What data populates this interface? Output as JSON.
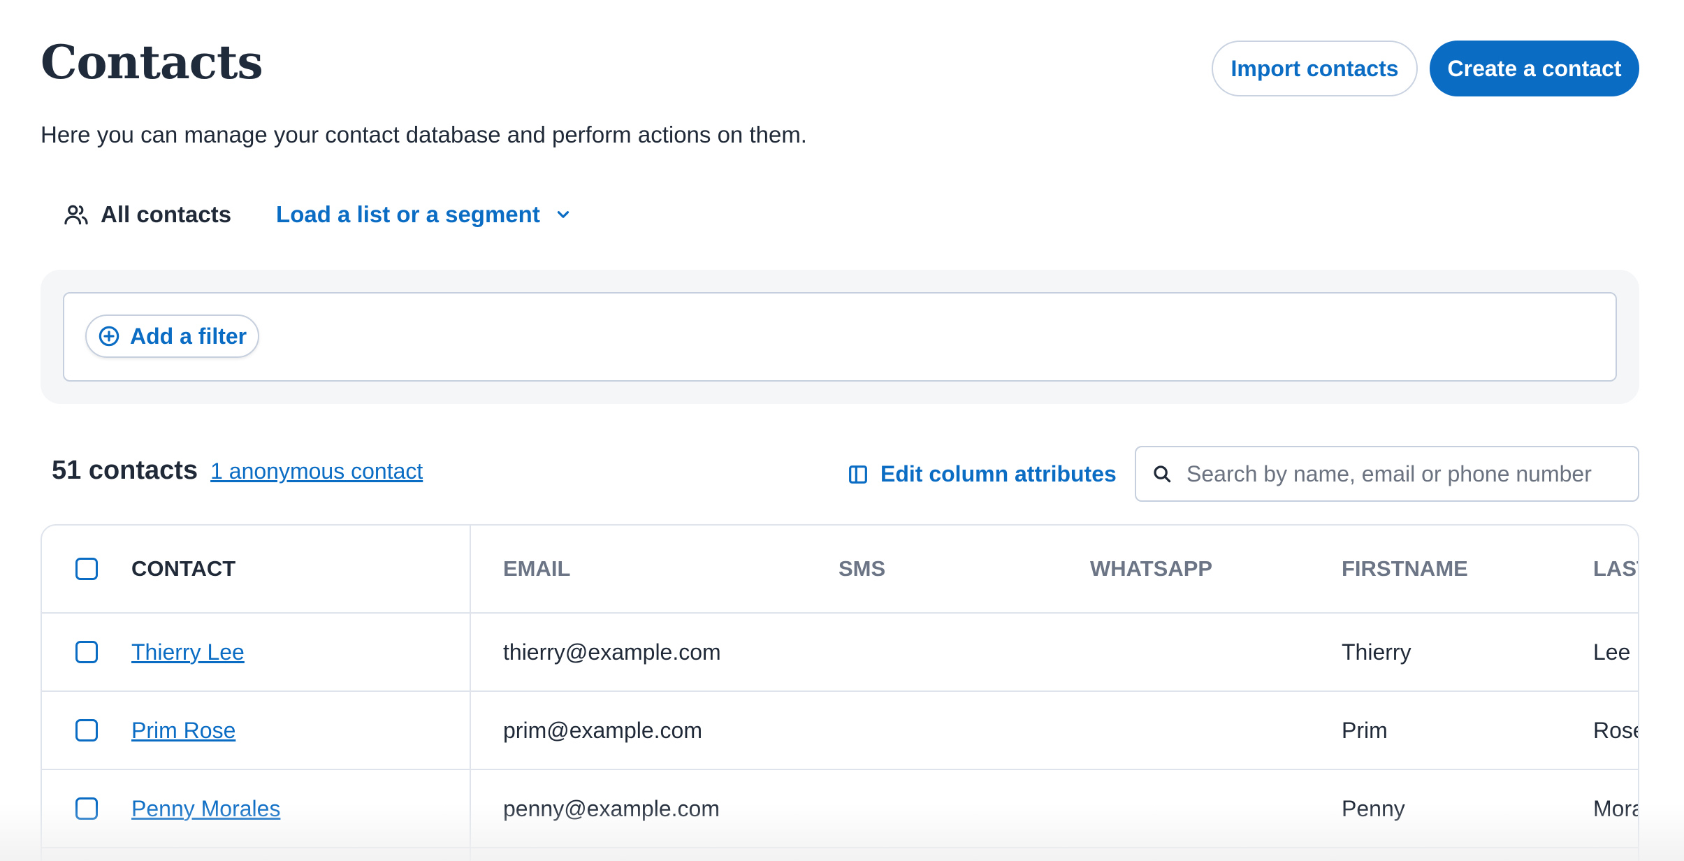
{
  "header": {
    "title": "Contacts",
    "subtitle": "Here you can manage your contact database and perform actions on them.",
    "import_label": "Import contacts",
    "create_label": "Create a contact"
  },
  "tabs": {
    "all_contacts": "All contacts",
    "load_list": "Load a list or a segment"
  },
  "filter": {
    "add_label": "Add a filter"
  },
  "summary": {
    "count": "51 contacts",
    "anonymous": "1 anonymous contact",
    "edit_columns": "Edit column attributes"
  },
  "search": {
    "placeholder": "Search by name, email or phone number",
    "value": ""
  },
  "table": {
    "columns": [
      "CONTACT",
      "EMAIL",
      "SMS",
      "WHATSAPP",
      "FIRSTNAME",
      "LAST"
    ],
    "rows": [
      {
        "contact": "Thierry Lee",
        "email": "thierry@example.com",
        "sms": "",
        "whatsapp": "",
        "firstname": "Thierry",
        "lastname": "Lee"
      },
      {
        "contact": "Prim Rose",
        "email": "prim@example.com",
        "sms": "",
        "whatsapp": "",
        "firstname": "Prim",
        "lastname": "Rose"
      },
      {
        "contact": "Penny Morales",
        "email": "penny@example.com",
        "sms": "",
        "whatsapp": "",
        "firstname": "Penny",
        "lastname": "Mora"
      }
    ]
  },
  "colors": {
    "accent": "#0b6cc4",
    "text": "#1f2937",
    "muted": "#6b7585",
    "border": "#dfe4ec"
  },
  "icons": {
    "users": "users-icon",
    "chevron": "chevron-down-icon",
    "plus_circle": "plus-circle-icon",
    "columns": "columns-icon",
    "search": "search-icon"
  }
}
